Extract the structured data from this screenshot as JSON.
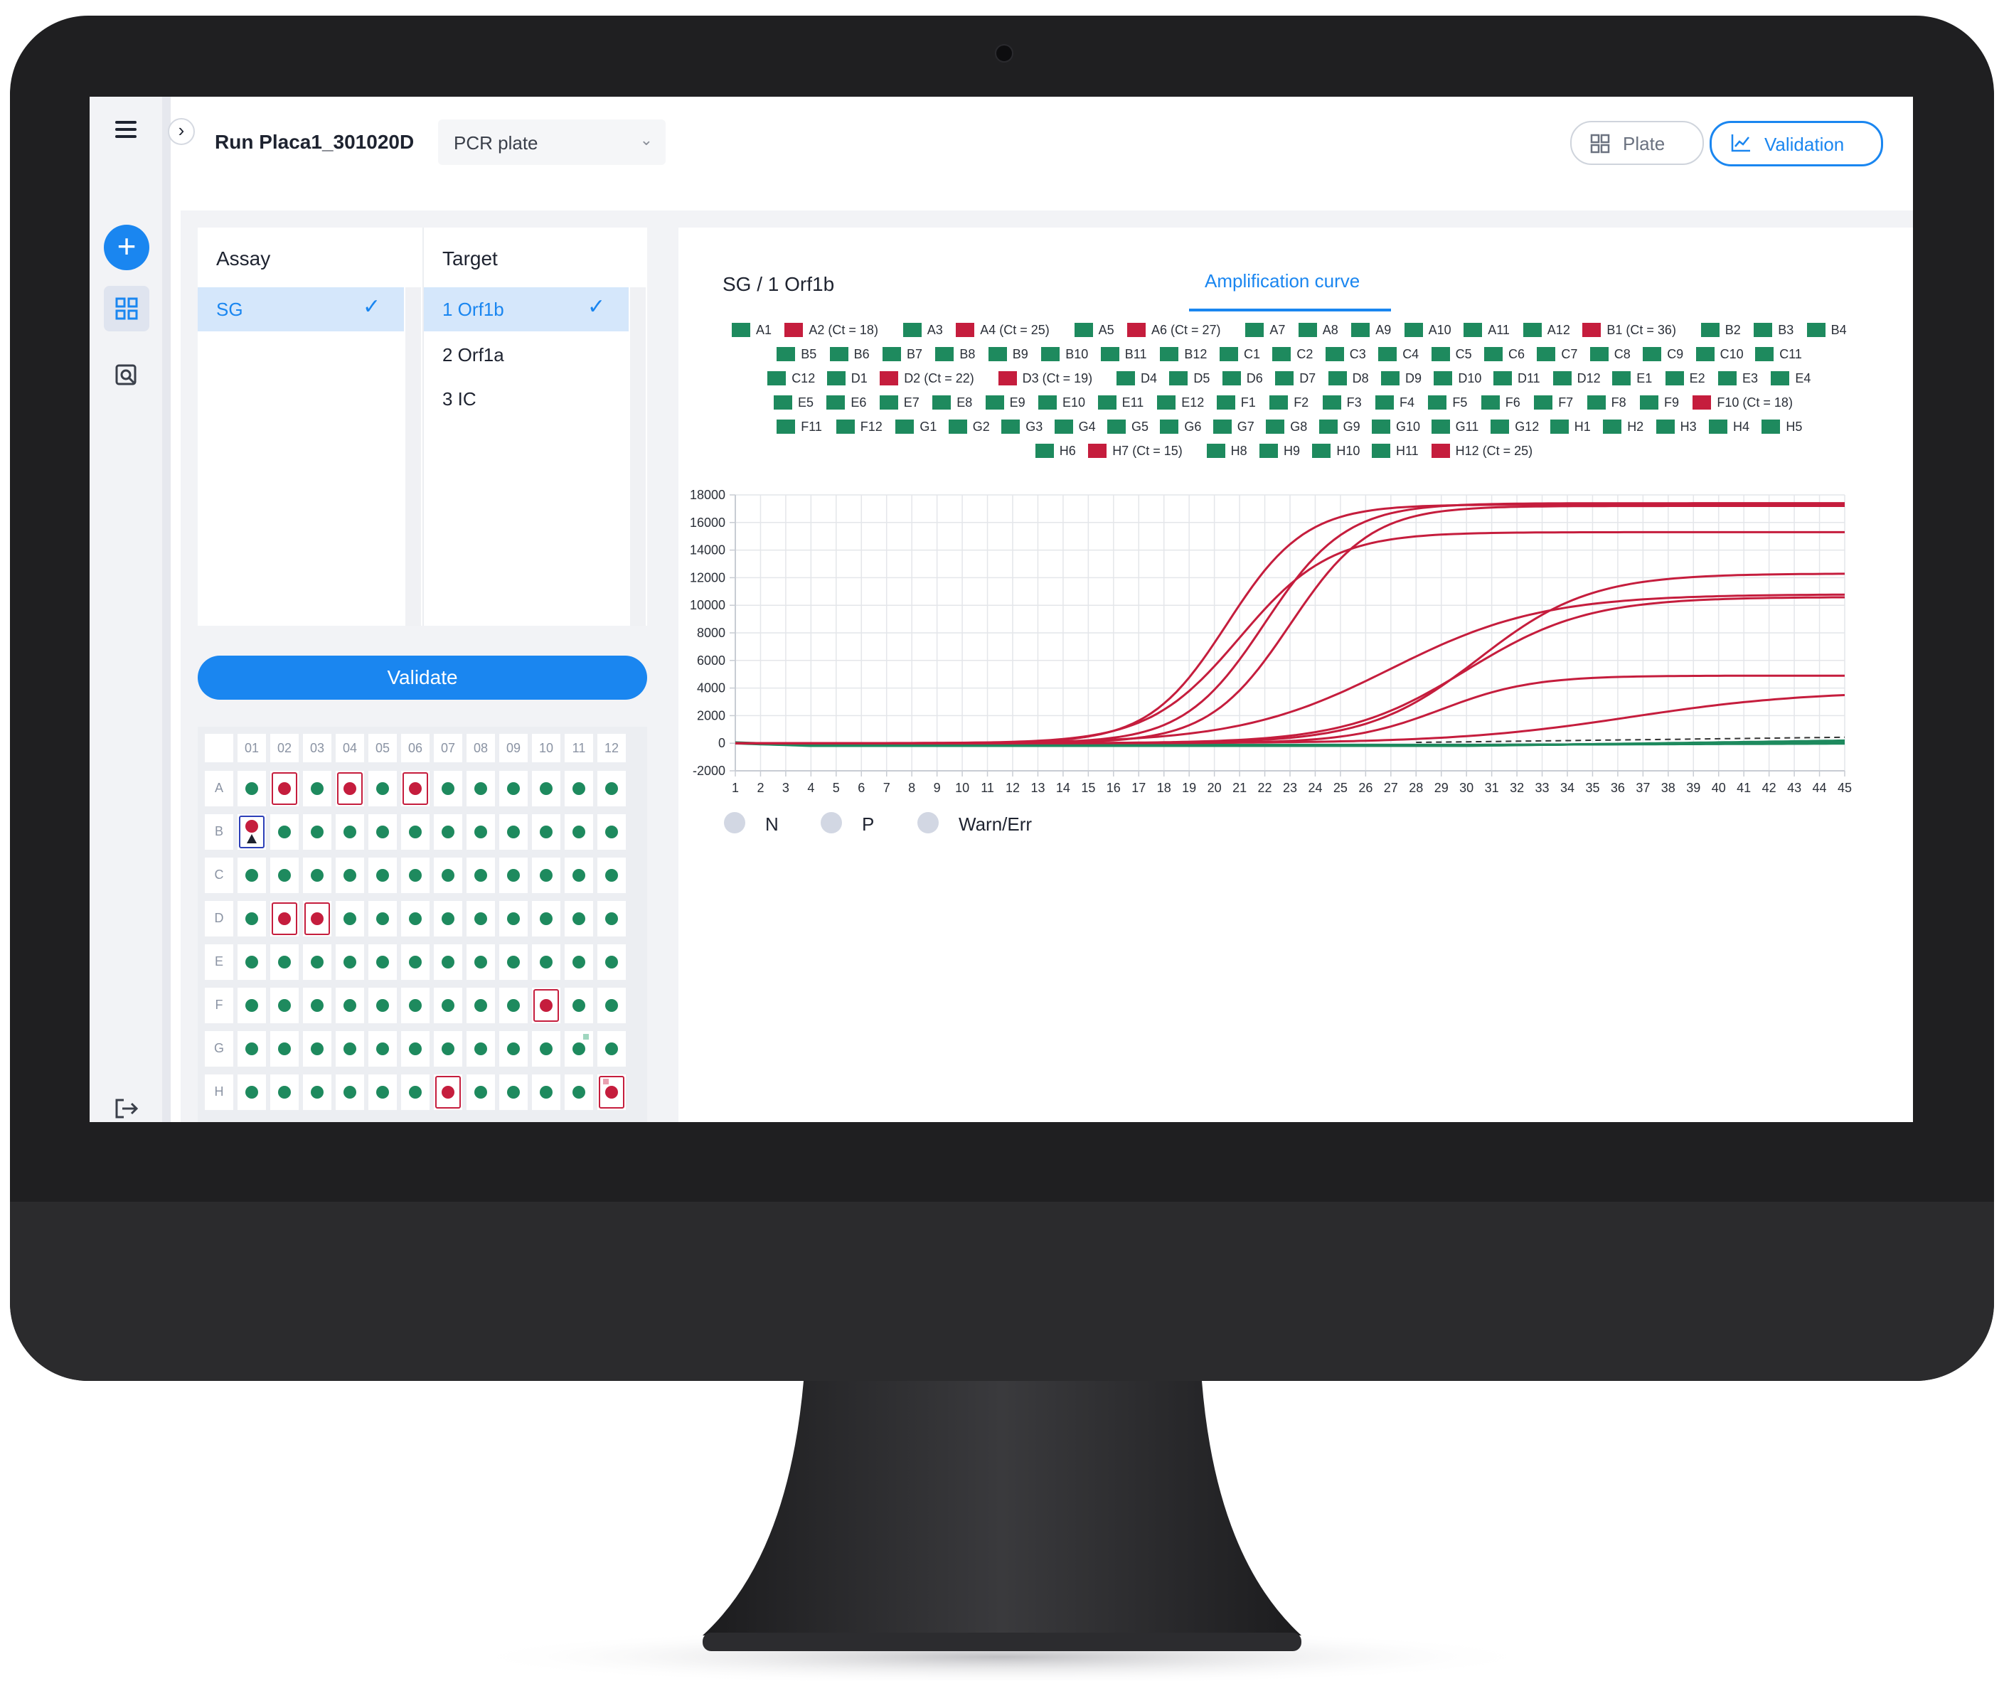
{
  "header": {
    "run_title": "Run Placa1_301020D",
    "plate_select": "PCR plate",
    "plate_toggle": "Plate",
    "validation_toggle": "Validation"
  },
  "assay_panel": {
    "assay_header": "Assay",
    "target_header": "Target",
    "assays": [
      "SG"
    ],
    "targets": [
      "1 Orf1b",
      "2 Orf1a",
      "3 IC"
    ],
    "selected_assay": "SG",
    "selected_target": "1 Orf1b"
  },
  "validate_label": "Validate",
  "plate": {
    "columns": [
      "01",
      "02",
      "03",
      "04",
      "05",
      "06",
      "07",
      "08",
      "09",
      "10",
      "11",
      "12"
    ],
    "rows": [
      "A",
      "B",
      "C",
      "D",
      "E",
      "F",
      "G",
      "H"
    ],
    "positive_wells": [
      "A2",
      "A4",
      "A6",
      "B1",
      "D2",
      "D3",
      "F10",
      "H7",
      "H12"
    ],
    "colors": {
      "negative": "#1e8a5e",
      "positive": "#c51d3d"
    }
  },
  "chart_title": "SG / 1 Orf1b",
  "chart_tab": "Amplification curve",
  "bottom_legend": [
    "N",
    "P",
    "Warn/Err"
  ],
  "chart_data": {
    "type": "line",
    "x_ticks": [
      1,
      2,
      3,
      4,
      5,
      6,
      7,
      8,
      9,
      10,
      11,
      12,
      13,
      14,
      15,
      16,
      17,
      18,
      19,
      20,
      21,
      22,
      23,
      24,
      25,
      26,
      27,
      28,
      29,
      30,
      31,
      32,
      33,
      34,
      35,
      36,
      37,
      38,
      39,
      40,
      41,
      42,
      43,
      44,
      45
    ],
    "y_ticks": [
      -2000,
      0,
      2000,
      4000,
      6000,
      8000,
      10000,
      12000,
      14000,
      16000,
      18000
    ],
    "xlim": [
      1,
      45
    ],
    "ylim": [
      -2000,
      18000
    ],
    "grid": true,
    "legend_position": "top",
    "legend": [
      {
        "label": "A1",
        "color": "#1e8a5e"
      },
      {
        "label": "A2 (Ct = 18)",
        "color": "#c51d3d"
      },
      {
        "label": "A3",
        "color": "#1e8a5e"
      },
      {
        "label": "A4 (Ct = 25)",
        "color": "#c51d3d"
      },
      {
        "label": "A5",
        "color": "#1e8a5e"
      },
      {
        "label": "A6 (Ct = 27)",
        "color": "#c51d3d"
      },
      {
        "label": "A7",
        "color": "#1e8a5e"
      },
      {
        "label": "A8",
        "color": "#1e8a5e"
      },
      {
        "label": "A9",
        "color": "#1e8a5e"
      },
      {
        "label": "A10",
        "color": "#1e8a5e"
      },
      {
        "label": "A11",
        "color": "#1e8a5e"
      },
      {
        "label": "A12",
        "color": "#1e8a5e"
      },
      {
        "label": "B1 (Ct = 36)",
        "color": "#c51d3d"
      },
      {
        "label": "B2",
        "color": "#1e8a5e"
      },
      {
        "label": "B3",
        "color": "#1e8a5e"
      },
      {
        "label": "B4",
        "color": "#1e8a5e"
      },
      {
        "label": "B5",
        "color": "#1e8a5e"
      },
      {
        "label": "B6",
        "color": "#1e8a5e"
      },
      {
        "label": "B7",
        "color": "#1e8a5e"
      },
      {
        "label": "B8",
        "color": "#1e8a5e"
      },
      {
        "label": "B9",
        "color": "#1e8a5e"
      },
      {
        "label": "B10",
        "color": "#1e8a5e"
      },
      {
        "label": "B11",
        "color": "#1e8a5e"
      },
      {
        "label": "B12",
        "color": "#1e8a5e"
      },
      {
        "label": "C1",
        "color": "#1e8a5e"
      },
      {
        "label": "C2",
        "color": "#1e8a5e"
      },
      {
        "label": "C3",
        "color": "#1e8a5e"
      },
      {
        "label": "C4",
        "color": "#1e8a5e"
      },
      {
        "label": "C5",
        "color": "#1e8a5e"
      },
      {
        "label": "C6",
        "color": "#1e8a5e"
      },
      {
        "label": "C7",
        "color": "#1e8a5e"
      },
      {
        "label": "C8",
        "color": "#1e8a5e"
      },
      {
        "label": "C9",
        "color": "#1e8a5e"
      },
      {
        "label": "C10",
        "color": "#1e8a5e"
      },
      {
        "label": "C11",
        "color": "#1e8a5e"
      },
      {
        "label": "C12",
        "color": "#1e8a5e"
      },
      {
        "label": "D1",
        "color": "#1e8a5e"
      },
      {
        "label": "D2 (Ct = 22)",
        "color": "#c51d3d"
      },
      {
        "label": "D3 (Ct = 19)",
        "color": "#c51d3d"
      },
      {
        "label": "D4",
        "color": "#1e8a5e"
      },
      {
        "label": "D5",
        "color": "#1e8a5e"
      },
      {
        "label": "D6",
        "color": "#1e8a5e"
      },
      {
        "label": "D7",
        "color": "#1e8a5e"
      },
      {
        "label": "D8",
        "color": "#1e8a5e"
      },
      {
        "label": "D9",
        "color": "#1e8a5e"
      },
      {
        "label": "D10",
        "color": "#1e8a5e"
      },
      {
        "label": "D11",
        "color": "#1e8a5e"
      },
      {
        "label": "D12",
        "color": "#1e8a5e"
      },
      {
        "label": "E1",
        "color": "#1e8a5e"
      },
      {
        "label": "E2",
        "color": "#1e8a5e"
      },
      {
        "label": "E3",
        "color": "#1e8a5e"
      },
      {
        "label": "E4",
        "color": "#1e8a5e"
      },
      {
        "label": "E5",
        "color": "#1e8a5e"
      },
      {
        "label": "E6",
        "color": "#1e8a5e"
      },
      {
        "label": "E7",
        "color": "#1e8a5e"
      },
      {
        "label": "E8",
        "color": "#1e8a5e"
      },
      {
        "label": "E9",
        "color": "#1e8a5e"
      },
      {
        "label": "E10",
        "color": "#1e8a5e"
      },
      {
        "label": "E11",
        "color": "#1e8a5e"
      },
      {
        "label": "E12",
        "color": "#1e8a5e"
      },
      {
        "label": "F1",
        "color": "#1e8a5e"
      },
      {
        "label": "F2",
        "color": "#1e8a5e"
      },
      {
        "label": "F3",
        "color": "#1e8a5e"
      },
      {
        "label": "F4",
        "color": "#1e8a5e"
      },
      {
        "label": "F5",
        "color": "#1e8a5e"
      },
      {
        "label": "F6",
        "color": "#1e8a5e"
      },
      {
        "label": "F7",
        "color": "#1e8a5e"
      },
      {
        "label": "F8",
        "color": "#1e8a5e"
      },
      {
        "label": "F9",
        "color": "#1e8a5e"
      },
      {
        "label": "F10 (Ct = 18)",
        "color": "#c51d3d"
      },
      {
        "label": "F11",
        "color": "#1e8a5e"
      },
      {
        "label": "F12",
        "color": "#1e8a5e"
      },
      {
        "label": "G1",
        "color": "#1e8a5e"
      },
      {
        "label": "G2",
        "color": "#1e8a5e"
      },
      {
        "label": "G3",
        "color": "#1e8a5e"
      },
      {
        "label": "G4",
        "color": "#1e8a5e"
      },
      {
        "label": "G5",
        "color": "#1e8a5e"
      },
      {
        "label": "G6",
        "color": "#1e8a5e"
      },
      {
        "label": "G7",
        "color": "#1e8a5e"
      },
      {
        "label": "G8",
        "color": "#1e8a5e"
      },
      {
        "label": "G9",
        "color": "#1e8a5e"
      },
      {
        "label": "G10",
        "color": "#1e8a5e"
      },
      {
        "label": "G11",
        "color": "#1e8a5e"
      },
      {
        "label": "G12",
        "color": "#1e8a5e"
      },
      {
        "label": "H1",
        "color": "#1e8a5e"
      },
      {
        "label": "H2",
        "color": "#1e8a5e"
      },
      {
        "label": "H3",
        "color": "#1e8a5e"
      },
      {
        "label": "H4",
        "color": "#1e8a5e"
      },
      {
        "label": "H5",
        "color": "#1e8a5e"
      },
      {
        "label": "H6",
        "color": "#1e8a5e"
      },
      {
        "label": "H7 (Ct = 15)",
        "color": "#c51d3d"
      },
      {
        "label": "H8",
        "color": "#1e8a5e"
      },
      {
        "label": "H9",
        "color": "#1e8a5e"
      },
      {
        "label": "H10",
        "color": "#1e8a5e"
      },
      {
        "label": "H11",
        "color": "#1e8a5e"
      },
      {
        "label": "H12 (Ct = 25)",
        "color": "#c51d3d"
      }
    ],
    "series": [
      {
        "name": "H7 (Ct = 15)",
        "color": "#c51d3d",
        "plateau": 17300,
        "midpoint": 20.5,
        "slope": 1.55
      },
      {
        "name": "A2 (Ct = 18)",
        "color": "#c51d3d",
        "plateau": 15300,
        "midpoint": 21.0,
        "slope": 1.8
      },
      {
        "name": "F10 (Ct = 18)",
        "color": "#c51d3d",
        "plateau": 17400,
        "midpoint": 22.0,
        "slope": 1.6
      },
      {
        "name": "D3 (Ct = 19)",
        "color": "#c51d3d",
        "plateau": 17200,
        "midpoint": 23.0,
        "slope": 1.6
      },
      {
        "name": "D2 (Ct = 22)",
        "color": "#c51d3d",
        "plateau": 10800,
        "midpoint": 27.0,
        "slope": 3.0
      },
      {
        "name": "A4 (Ct = 25)",
        "color": "#c51d3d",
        "plateau": 12300,
        "midpoint": 30.5,
        "slope": 2.2
      },
      {
        "name": "H12 (Ct = 25)",
        "color": "#c51d3d",
        "plateau": 10600,
        "midpoint": 30.0,
        "slope": 2.4
      },
      {
        "name": "A6 (Ct = 27)",
        "color": "#c51d3d",
        "plateau": 4900,
        "midpoint": 29.0,
        "slope": 1.8
      },
      {
        "name": "B1 (Ct = 36)",
        "color": "#c51d3d",
        "plateau": 3800,
        "midpoint": 36.5,
        "slope": 3.5
      }
    ],
    "negative_baseline": 0
  }
}
